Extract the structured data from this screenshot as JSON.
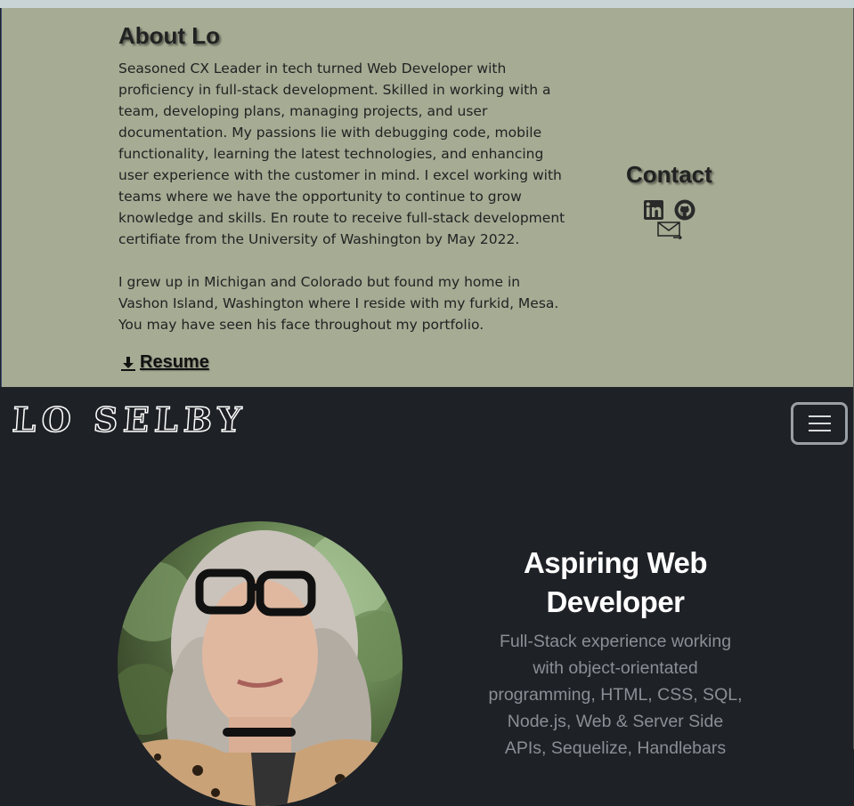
{
  "about": {
    "title": "About Lo",
    "paragraph1": "Seasoned CX Leader in tech turned Web Developer with proficiency in full-stack development. Skilled in working with a team, developing plans, managing projects, and user documentation. My passions lie with debugging code, mobile functionality, learning the latest technologies, and enhancing user experience with the customer in mind. I excel working with teams where we have the opportunity to continue to grow knowledge and skills. En route to receive full-stack development certifiate from the University of Washington by May 2022.",
    "paragraph2": "I grew up in Michigan and Colorado but found my home in Vashon Island, Washington where I reside with my furkid, Mesa. You may have seen his face throughout my portfolio.",
    "resume_label": "Resume",
    "resume_icon": "download-icon"
  },
  "contact": {
    "title": "Contact",
    "icons": [
      "linkedin-icon",
      "github-icon",
      "email-icon"
    ]
  },
  "navbar": {
    "brand": "LO SELBY",
    "menu_icon": "hamburger-icon"
  },
  "hero": {
    "title": "Aspiring Web Developer",
    "description": "Full-Stack experience working with object-orientated programming, HTML, CSS, SQL, Node.js, Web & Server Side APIs, Sequelize, Handlebars"
  },
  "colors": {
    "about_bg": "#a6ab94",
    "dark_bg": "#1e2126",
    "hero_text": "#8a8f96"
  }
}
